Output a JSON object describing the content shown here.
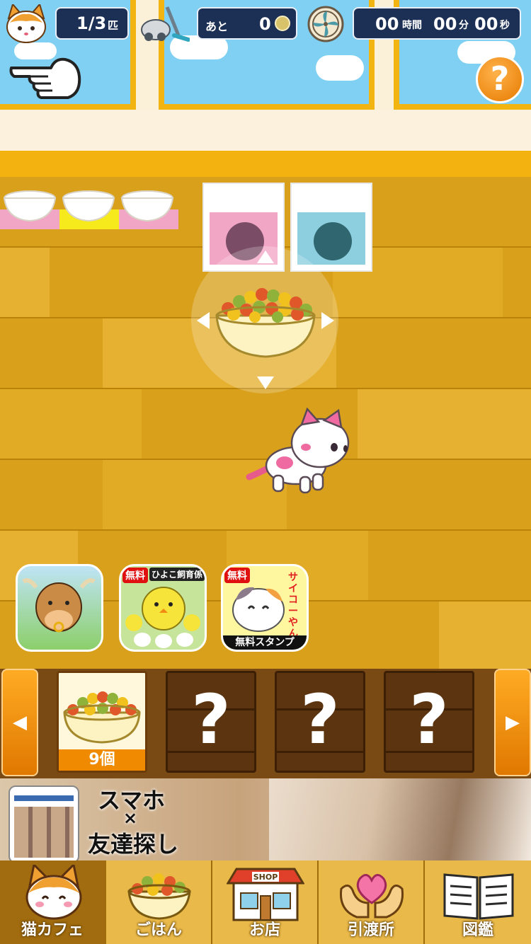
{
  "hud": {
    "cat_count": "1/3",
    "cat_unit": "匹",
    "remaining_label": "あと",
    "coins": "0",
    "hours": "00",
    "hours_unit": "時間",
    "minutes": "00",
    "minutes_unit": "分",
    "seconds": "00",
    "seconds_unit": "秒"
  },
  "help": {
    "label": "?"
  },
  "promos": [
    {
      "name": "cow-farm-app",
      "tag": ""
    },
    {
      "name": "chick-app",
      "tag": "無料",
      "title": "ひよこ飼育係"
    },
    {
      "name": "cat-stamp-app",
      "tag": "無料",
      "title": "サイコーやん",
      "footer": "無料スタンプ"
    }
  ],
  "tray": {
    "left_arrow": "◀",
    "right_arrow": "▶",
    "slots": [
      {
        "state": "active",
        "count": "9個"
      },
      {
        "state": "locked",
        "label": "?"
      },
      {
        "state": "locked",
        "label": "?"
      },
      {
        "state": "locked",
        "label": "?"
      }
    ]
  },
  "ad": {
    "line1": "スマホ",
    "line2": "×",
    "line3": "友達探し"
  },
  "nav": {
    "items": [
      {
        "label": "猫カフェ",
        "icon": "cat-face-icon"
      },
      {
        "label": "ごはん",
        "icon": "food-bowl-icon"
      },
      {
        "label": "お店",
        "icon": "shop-icon",
        "sign": "SHOP"
      },
      {
        "label": "引渡所",
        "icon": "heart-hands-icon"
      },
      {
        "label": "図鑑",
        "icon": "book-icon"
      }
    ]
  },
  "colors": {
    "accent_orange": "#f08a00",
    "hud_navy": "#1c2f55",
    "floor": "#d9a11b"
  }
}
